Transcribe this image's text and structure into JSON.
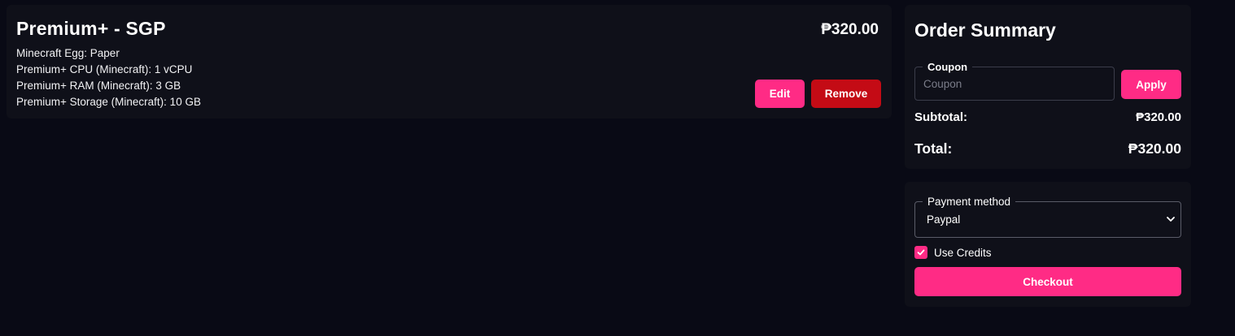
{
  "cart": {
    "items": [
      {
        "title": "Premium+ - SGP",
        "price": "₱320.00",
        "details": [
          "Minecraft Egg: Paper",
          "Premium+ CPU (Minecraft): 1 vCPU",
          "Premium+ RAM (Minecraft): 3 GB",
          "Premium+ Storage (Minecraft): 10 GB"
        ],
        "edit_label": "Edit",
        "remove_label": "Remove"
      }
    ]
  },
  "summary": {
    "title": "Order Summary",
    "coupon": {
      "legend": "Coupon",
      "placeholder": "Coupon",
      "value": ""
    },
    "apply_label": "Apply",
    "subtotal_label": "Subtotal:",
    "subtotal_value": "₱320.00",
    "total_label": "Total:",
    "total_value": "₱320.00"
  },
  "payment": {
    "legend": "Payment method",
    "selected": "Paypal",
    "use_credits_label": "Use Credits",
    "use_credits_checked": true,
    "checkout_label": "Checkout"
  },
  "colors": {
    "background": "#090a15",
    "card": "#0f1019",
    "accent": "#ff2b85",
    "danger": "#c40b15"
  }
}
